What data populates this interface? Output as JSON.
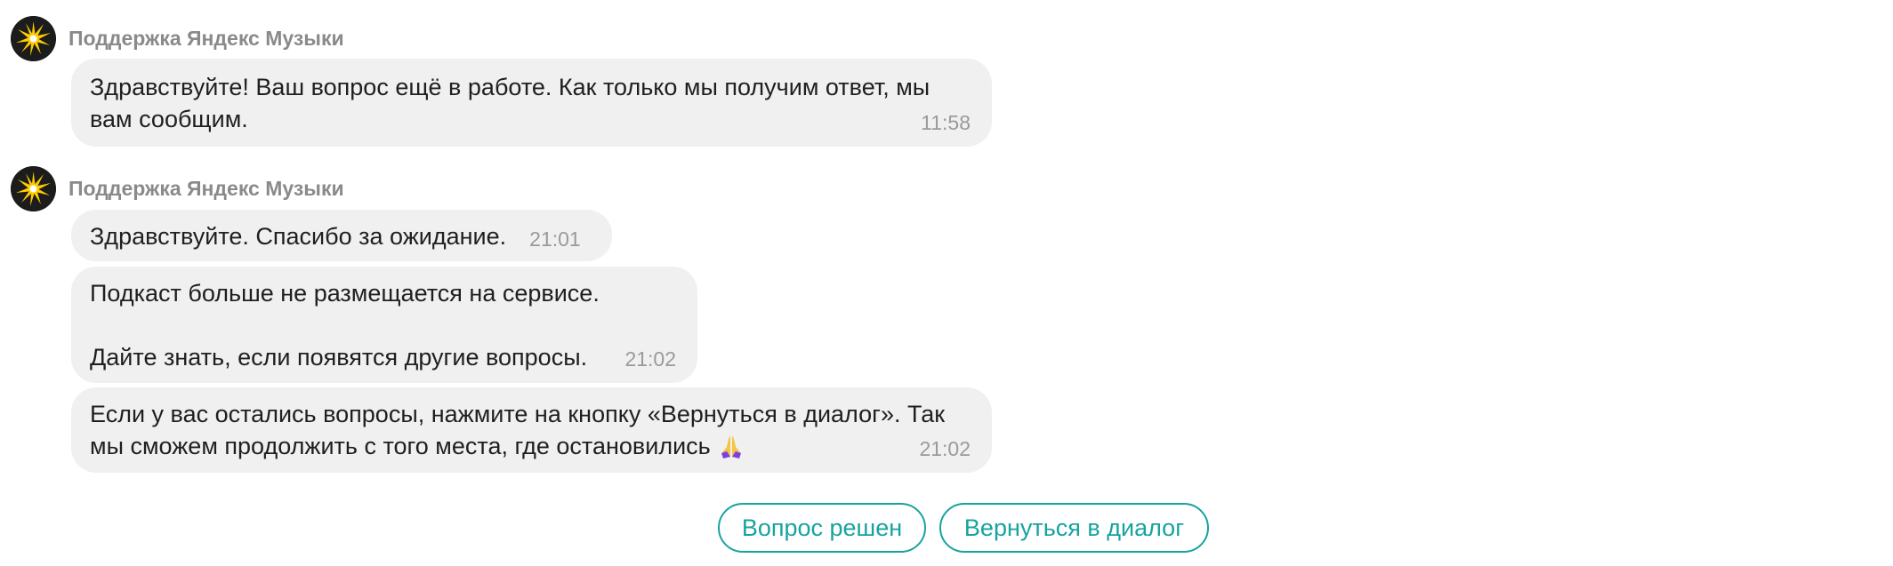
{
  "colors": {
    "accent": "#17a3a0",
    "bubble_bg": "#f0f0f0",
    "sender_text": "#8a8a8a",
    "time_text": "#9a9a9a"
  },
  "messages": [
    {
      "sender": "Поддержка Яндекс Музыки",
      "avatar_icon": "yandex-music-logo-icon",
      "bubbles": [
        {
          "text": "Здравствуйте! Ваш вопрос ещё в работе. Как только мы получим ответ, мы\nвам сообщим.",
          "time": "11:58"
        }
      ]
    },
    {
      "sender": "Поддержка Яндекс Музыки",
      "avatar_icon": "yandex-music-logo-icon",
      "bubbles": [
        {
          "text": "Здравствуйте. Спасибо за ожидание.",
          "time": "21:01"
        },
        {
          "text": "Подкаст больше не размещается на сервисе.\n\nДайте знать, если появятся другие вопросы.",
          "time": "21:02"
        },
        {
          "text": "Если у вас остались вопросы, нажмите на кнопку «Вернуться в диалог». Так\nмы сможем продолжить с того места, где остановились",
          "emoji": "folded-hands-emoji",
          "time": "21:02"
        }
      ]
    }
  ],
  "actions": {
    "resolved_label": "Вопрос решен",
    "return_label": "Вернуться в диалог"
  }
}
